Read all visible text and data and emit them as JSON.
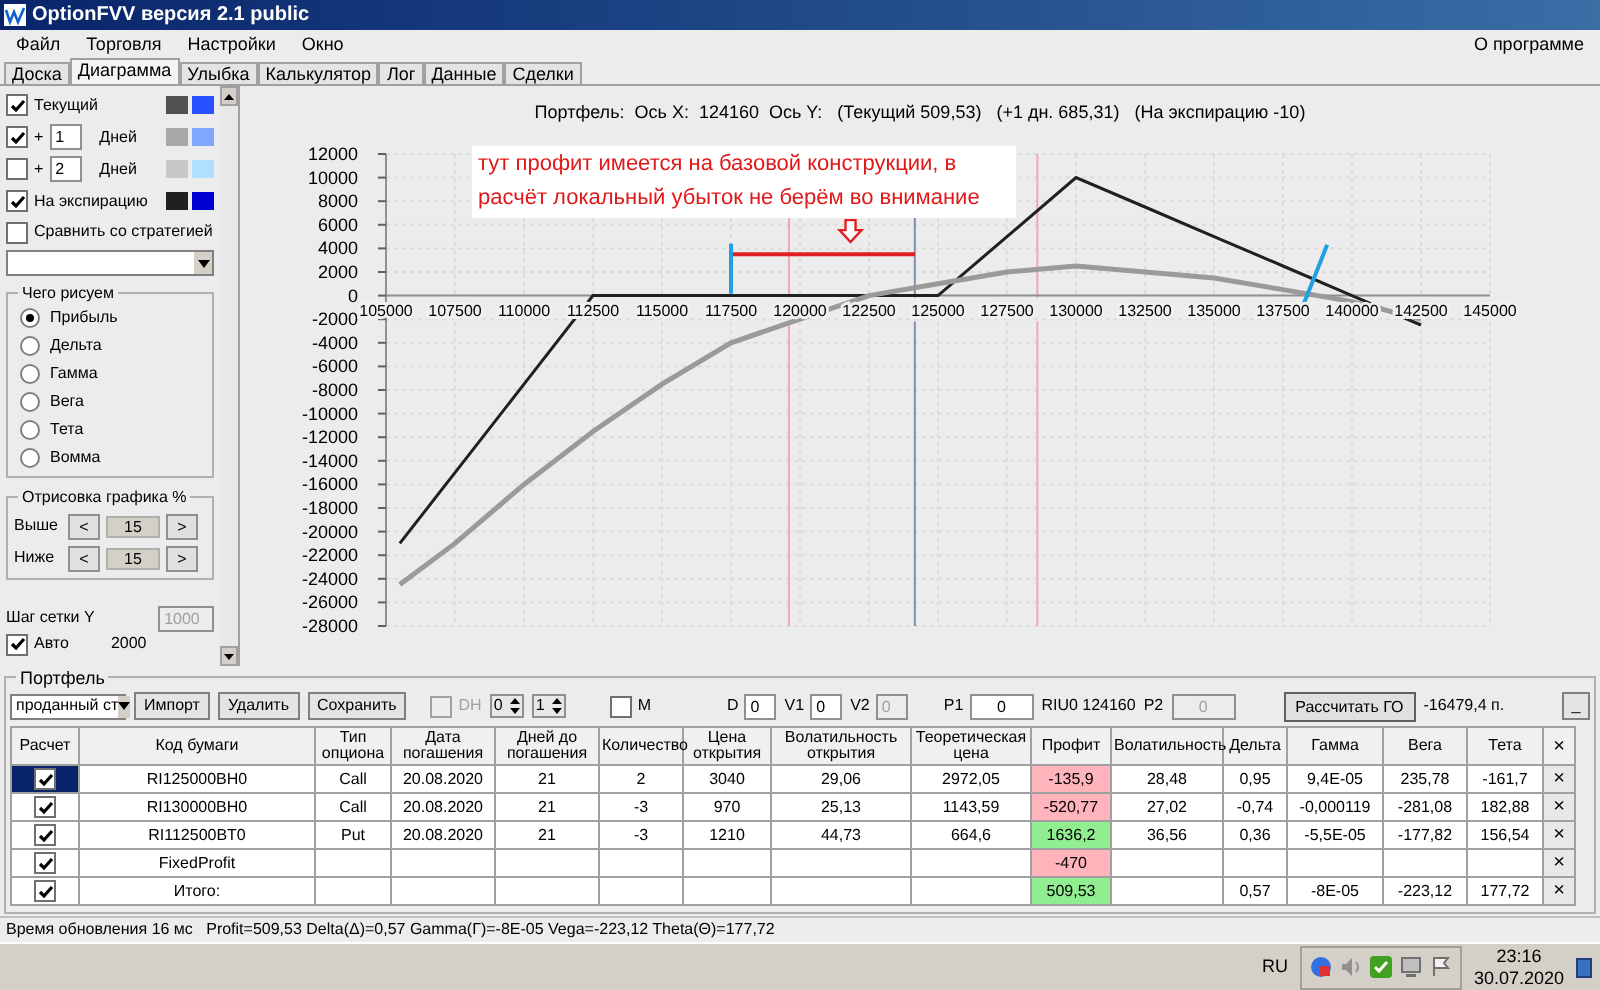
{
  "window": {
    "title": "OptionFVV версия 2.1 public"
  },
  "menu": [
    "Файл",
    "Торговля",
    "Настройки",
    "Окно"
  ],
  "menu_right": "О программе",
  "tabs": [
    {
      "label": "Доска",
      "selected": false
    },
    {
      "label": "Диаграмма",
      "selected": true
    },
    {
      "label": "Улыбка",
      "selected": false
    },
    {
      "label": "Калькулятор",
      "selected": false
    },
    {
      "label": "Лог",
      "selected": false
    },
    {
      "label": "Данные",
      "selected": false
    },
    {
      "label": "Сделки",
      "selected": false
    }
  ],
  "series_settings": [
    {
      "kind": "label",
      "checked": true,
      "label": "Текущий",
      "swatches": [
        {
          "color": "#505050"
        },
        {
          "color": "#2850ff"
        }
      ]
    },
    {
      "kind": "days",
      "checked": true,
      "prefix": "+",
      "days": "1",
      "unit": "Дней",
      "swatches": [
        {
          "color": "#a8a8a8"
        },
        {
          "color": "#80a8ff"
        }
      ]
    },
    {
      "kind": "days",
      "checked": false,
      "prefix": "+",
      "days": "2",
      "unit": "Дней",
      "swatches": [
        {
          "color": "#c8c8c8"
        },
        {
          "color": "#b0e0ff"
        }
      ]
    },
    {
      "kind": "label",
      "checked": true,
      "label": "На экспирацию",
      "swatches": [
        {
          "color": "#202020"
        },
        {
          "color": "#0000d0"
        }
      ]
    }
  ],
  "compare": {
    "checked": false,
    "label": "Сравнить со стратегией"
  },
  "draw_group": {
    "title": "Чего рисуем",
    "options": [
      {
        "label": "Прибыль",
        "selected": true
      },
      {
        "label": "Дельта",
        "selected": false
      },
      {
        "label": "Гамма",
        "selected": false
      },
      {
        "label": "Вега",
        "selected": false
      },
      {
        "label": "Тета",
        "selected": false
      },
      {
        "label": "Вомма",
        "selected": false
      }
    ]
  },
  "range_group": {
    "title": "Отрисовка графика %",
    "rows": [
      {
        "label": "Выше",
        "prev": "<",
        "value": "15",
        "next": ">"
      },
      {
        "label": "Ниже",
        "prev": "<",
        "value": "15",
        "next": ">"
      }
    ]
  },
  "grid": {
    "label": "Шаг сетки Y",
    "value": "1000",
    "disabled": true,
    "auto": {
      "checked": true,
      "label": "Авто",
      "value": "2000"
    }
  },
  "chart": {
    "title": "Портфель:  Ось X:  124160  Ось Y:   (Текущий 509,53)   (+1 дн. 685,31)   (На экспирацию -10)",
    "chart_data": {
      "type": "line",
      "grid": true,
      "x": [
        105500,
        107500,
        110000,
        112500,
        115000,
        117500,
        120000,
        122500,
        125000,
        127500,
        130000,
        132500,
        135000,
        137500,
        140000,
        142500
      ],
      "series": [
        {
          "color": "#202020",
          "values": [
            -21000,
            -15000,
            -7500,
            0,
            0,
            0,
            0,
            0,
            0,
            5000,
            10000,
            7500,
            5000,
            2500,
            0,
            -2500
          ]
        },
        {
          "color": "#9a9a9a",
          "values": [
            -24500,
            -21000,
            -16000,
            -11500,
            -7500,
            -4000,
            -2000,
            0,
            1000,
            2000,
            2500,
            2000,
            1500,
            500,
            -500,
            -2000
          ]
        }
      ],
      "xlim": [
        105000,
        145000
      ],
      "ylim": [
        -28000,
        12000
      ],
      "xticks": [
        105000,
        107500,
        110000,
        112500,
        115000,
        117500,
        120000,
        122500,
        125000,
        127500,
        130000,
        132500,
        135000,
        137500,
        140000,
        142500,
        145000
      ],
      "yticks": [
        12000,
        10000,
        8000,
        6000,
        4000,
        2000,
        0,
        -2000,
        -4000,
        -6000,
        -8000,
        -10000,
        -12000,
        -14000,
        -16000,
        -18000,
        -20000,
        -22000,
        -24000,
        -26000,
        -28000
      ],
      "ref_lines": [
        {
          "axis": "x",
          "value": 119600,
          "color": "#f0a8b8"
        },
        {
          "axis": "x",
          "value": 128600,
          "color": "#f0a8b8"
        },
        {
          "axis": "x",
          "value": 124160,
          "color": "#8090a8"
        }
      ],
      "annotations": [
        {
          "text": "тут профит имеется на базовой конструкции, в расчёт локальный убыток не берём во внимание"
        }
      ]
    }
  },
  "portfolio": {
    "title": "Портфель",
    "filter": "проданный ст",
    "buttons": [
      "Импорт",
      "Удалить",
      "Сохранить"
    ],
    "dh": {
      "label": "DH",
      "checked": false,
      "disabled": true
    },
    "spins": [
      "0",
      "1"
    ],
    "m": {
      "label": "M",
      "checked": false
    },
    "fields": [
      {
        "label": "D",
        "value": "0",
        "disabled": false
      },
      {
        "label": "V1",
        "value": "0",
        "disabled": false
      },
      {
        "label": "V2",
        "value": "0",
        "disabled": true
      },
      {
        "label": "P1",
        "value": "0",
        "disabled": false
      }
    ],
    "ticker": "RIU0 124160",
    "p2": {
      "label": "P2",
      "value": "0",
      "disabled": true
    },
    "calc_button": "Рассчитать ГО",
    "margin": "-16479,4 п.",
    "minimize": "_"
  },
  "table": {
    "check_column": "Расчет",
    "columns": [
      "Код бумаги",
      "Тип опциона",
      "Дата погашения",
      "Дней до погашения",
      "Количество",
      "Цена открытия",
      "Волатильность открытия",
      "Теоретическая цена",
      "Профит",
      "Волатильность",
      "Дельта",
      "Гамма",
      "Вега",
      "Тета"
    ],
    "remove_column": "×",
    "rows": [
      {
        "checked": true,
        "selected": true,
        "color": "#ffb3ba",
        "cells": [
          "RI125000BH0",
          "Call",
          "20.08.2020",
          "21",
          "2",
          "3040",
          "29,06",
          "2972,05",
          "-135,9",
          "28,48",
          "0,95",
          "9,4E-05",
          "235,78",
          "-161,7"
        ],
        "remove": "×"
      },
      {
        "checked": true,
        "selected": false,
        "color": "#ffb3ba",
        "cells": [
          "RI130000BH0",
          "Call",
          "20.08.2020",
          "21",
          "-3",
          "970",
          "25,13",
          "1143,59",
          "-520,77",
          "27,02",
          "-0,74",
          "-0,000119",
          "-281,08",
          "182,88"
        ],
        "remove": "×"
      },
      {
        "checked": true,
        "selected": false,
        "color": "#90ee90",
        "cells": [
          "RI112500BT0",
          "Put",
          "20.08.2020",
          "21",
          "-3",
          "1210",
          "44,73",
          "664,6",
          "1636,2",
          "36,56",
          "0,36",
          "-5,5E-05",
          "-177,82",
          "156,54"
        ],
        "remove": "×"
      },
      {
        "checked": true,
        "selected": false,
        "color": "#ffb3ba",
        "cells": [
          "FixedProfit",
          null,
          null,
          null,
          null,
          null,
          null,
          null,
          "-470",
          null,
          null,
          null,
          null,
          null
        ],
        "remove": "×"
      },
      {
        "checked": true,
        "selected": false,
        "color": "#90ee90",
        "cells": [
          "Итого:",
          null,
          null,
          null,
          null,
          null,
          null,
          null,
          "509,53",
          null,
          "0,57",
          "-8E-05",
          "-223,12",
          "177,72"
        ],
        "remove": "×"
      }
    ]
  },
  "status_bar": "Время обновления 16 мс   Profit=509,53 Delta(Δ)=0,57 Gamma(Γ)=-8E-05 Vega=-223,12 Theta(Θ)=177,72",
  "taskbar": {
    "lang": "RU",
    "time": "23:16",
    "date": "30.07.2020"
  }
}
